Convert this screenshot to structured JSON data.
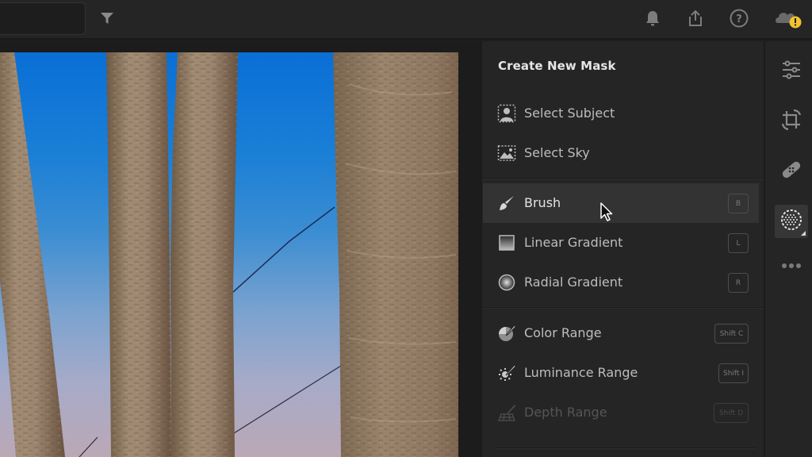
{
  "topbar": {
    "search": {
      "value": "",
      "placeholder": ""
    },
    "icons": {
      "filter": "filter-icon",
      "notifications": "bell-icon",
      "share": "share-icon",
      "help": "help-icon",
      "cloud_status": "cloud-warning-icon"
    },
    "cloud_warning_color": "#f2c12e"
  },
  "mask_panel": {
    "title": "Create New Mask",
    "items": [
      {
        "label": "Select Subject",
        "icon": "select-subject-icon",
        "shortcut": null,
        "state": "normal"
      },
      {
        "label": "Select Sky",
        "icon": "select-sky-icon",
        "shortcut": null,
        "state": "normal"
      },
      {
        "label": "Brush",
        "icon": "brush-icon",
        "shortcut": "B",
        "state": "hover"
      },
      {
        "label": "Linear Gradient",
        "icon": "linear-gradient-icon",
        "shortcut": "L",
        "state": "normal"
      },
      {
        "label": "Radial Gradient",
        "icon": "radial-gradient-icon",
        "shortcut": "R",
        "state": "normal"
      },
      {
        "label": "Color Range",
        "icon": "color-range-icon",
        "shortcut": "Shift C",
        "state": "normal"
      },
      {
        "label": "Luminance Range",
        "icon": "luminance-range-icon",
        "shortcut": "Shift I",
        "state": "normal"
      },
      {
        "label": "Depth Range",
        "icon": "depth-range-icon",
        "shortcut": "Shift D",
        "state": "disabled"
      }
    ]
  },
  "toolstrip": {
    "tools": [
      {
        "name": "edit",
        "icon": "sliders-icon",
        "active": false
      },
      {
        "name": "crop",
        "icon": "crop-rotate-icon",
        "active": false
      },
      {
        "name": "healing",
        "icon": "bandage-icon",
        "active": false
      },
      {
        "name": "masking",
        "icon": "masking-icon",
        "active": true
      },
      {
        "name": "more",
        "icon": "more-icon",
        "active": false
      }
    ]
  },
  "canvas": {
    "photo_description": "palm tree trunks against blue-to-pink twilight sky with wires"
  }
}
